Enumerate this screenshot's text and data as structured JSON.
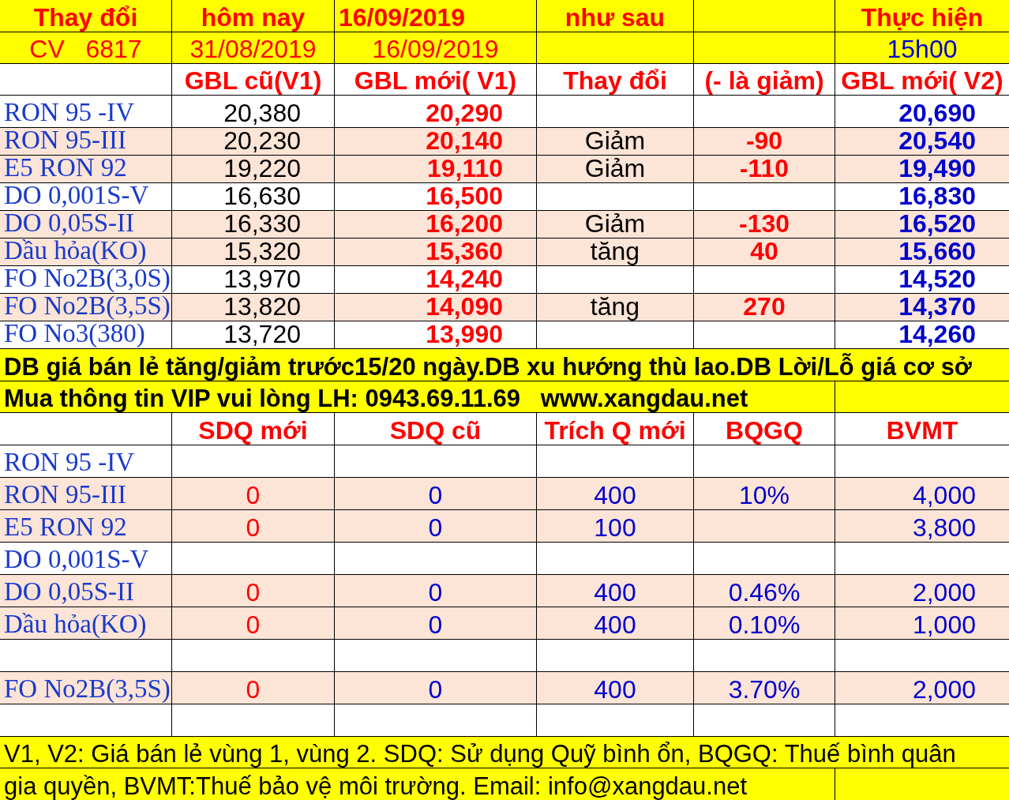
{
  "header_rows": [
    {
      "kind": "title",
      "cells": [
        "Thay đổi",
        "hôm nay",
        "16/09/2019",
        "như sau",
        null,
        "Thực hiện"
      ]
    },
    {
      "kind": "date",
      "cells": [
        "CV   6817",
        "31/08/2019",
        "16/09/2019",
        null,
        null,
        "15h00"
      ]
    }
  ],
  "price_table": {
    "columns": [
      null,
      "GBL cũ(V1)",
      "GBL mới( V1)",
      "Thay đổi",
      "(- là giảm)",
      "GBL mới( V2)"
    ],
    "rows": [
      {
        "name": "RON 95 -IV",
        "old": "20,380",
        "new": "20,290",
        "v2": "20,690",
        "shaded": false
      },
      {
        "name": "RON 95-III",
        "old": "20,230",
        "new": "20,140",
        "change": "Giảm",
        "delta": "-90",
        "v2": "20,540",
        "shaded": true
      },
      {
        "name": "E5 RON 92",
        "old": "19,220",
        "new": "19,110",
        "change": "Giảm",
        "delta": "-110",
        "v2": "19,490",
        "shaded": true
      },
      {
        "name": "DO 0,001S-V",
        "old": "16,630",
        "new": "16,500",
        "v2": "16,830",
        "shaded": false
      },
      {
        "name": "DO 0,05S-II",
        "old": "16,330",
        "new": "16,200",
        "change": "Giảm",
        "delta": "-130",
        "v2": "16,520",
        "shaded": true
      },
      {
        "name": "Dầu hỏa(KO)",
        "old": "15,320",
        "new": "15,360",
        "change": "tăng",
        "delta": "40",
        "v2": "15,660",
        "shaded": true
      },
      {
        "name": "FO No2B(3,0S)",
        "old": "13,970",
        "new": "14,240",
        "v2": "14,520",
        "shaded": false
      },
      {
        "name": "FO No2B(3,5S)",
        "old": "13,820",
        "new": "14,090",
        "change": "tăng",
        "delta": "270",
        "v2": "14,370",
        "shaded": true
      },
      {
        "name": "FO No3(380)",
        "old": "13,720",
        "new": "13,990",
        "v2": "14,260",
        "shaded": false
      }
    ]
  },
  "notices": [
    {
      "kind": "full",
      "text": "DB giá bán lẻ tăng/giảm trước15/20 ngày.DB xu hướng thù lao.DB Lời/Lỗ giá cơ sở"
    },
    {
      "kind": "split",
      "text": "Mua thông tin VIP vui lòng LH: 0943.69.11.69   www.xangdau.net"
    }
  ],
  "quota_table": {
    "columns": [
      null,
      "SDQ mới",
      "SDQ cũ",
      "Trích Q mới",
      "BQGQ",
      "BVMT"
    ],
    "rows": [
      {
        "name": "RON 95 -IV",
        "shaded": false
      },
      {
        "name": "RON 95-III",
        "sdq_new": "0",
        "sdq_old": "0",
        "trich_q": "400",
        "bqgq": "10%",
        "bvmt": "4,000",
        "shaded": true
      },
      {
        "name": "E5 RON 92",
        "sdq_new": "0",
        "sdq_old": "0",
        "trich_q": "100",
        "bvmt": "3,800",
        "shaded": true
      },
      {
        "name": "DO 0,001S-V",
        "shaded": false
      },
      {
        "name": "DO 0,05S-II",
        "sdq_new": "0",
        "sdq_old": "0",
        "trich_q": "400",
        "bqgq": "0.46%",
        "bvmt": "2,000",
        "shaded": true
      },
      {
        "name": "Dầu hỏa(KO)",
        "sdq_new": "0",
        "sdq_old": "0",
        "trich_q": "400",
        "bqgq": "0.10%",
        "bvmt": "1,000",
        "shaded": true
      },
      {
        "shaded": false
      },
      {
        "name": "FO No2B(3,5S)",
        "sdq_new": "0",
        "sdq_old": "0",
        "trich_q": "400",
        "bqgq": "3.70%",
        "bvmt": "2,000",
        "shaded": true
      },
      {
        "shaded": false
      }
    ]
  },
  "footer": [
    {
      "kind": "full",
      "text": "V1, V2: Giá bán lẻ vùng 1, vùng 2. SDQ: Sử dụng Quỹ bình ổn, BQGQ: Thuế bình quân"
    },
    {
      "kind": "split",
      "text": "gia quyền, BVMT:Thuế bảo vệ môi trường. Email: info@xangdau.net"
    }
  ]
}
